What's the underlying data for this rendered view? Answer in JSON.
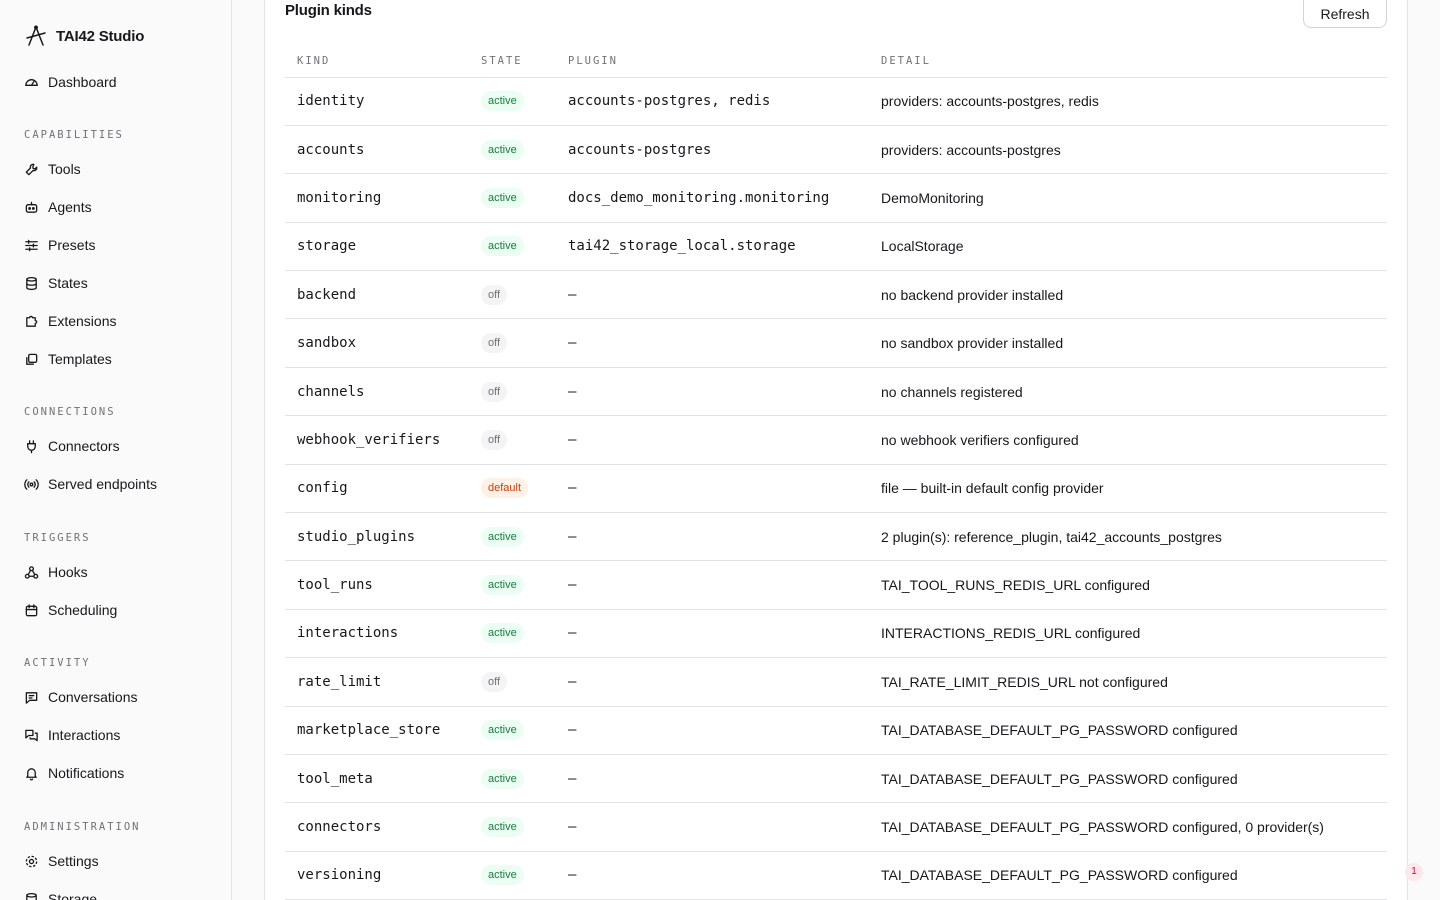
{
  "brand": {
    "name": "TAI42 Studio"
  },
  "nav": {
    "dashboard": "Dashboard",
    "sections": {
      "capabilities": "CAPABILITIES",
      "connections": "CONNECTIONS",
      "triggers": "TRIGGERS",
      "activity": "ACTIVITY",
      "administration": "ADMINISTRATION"
    },
    "items": {
      "tools": "Tools",
      "agents": "Agents",
      "presets": "Presets",
      "states": "States",
      "extensions": "Extensions",
      "templates": "Templates",
      "connectors": "Connectors",
      "served_endpoints": "Served endpoints",
      "hooks": "Hooks",
      "scheduling": "Scheduling",
      "conversations": "Conversations",
      "interactions": "Interactions",
      "notifications": "Notifications",
      "settings": "Settings",
      "storage": "Storage"
    }
  },
  "card": {
    "title": "Plugin kinds",
    "refresh_label": "Refresh",
    "columns": [
      "KIND",
      "STATE",
      "PLUGIN",
      "DETAIL"
    ],
    "rows": [
      {
        "kind": "identity",
        "state": "active",
        "plugin": "accounts-postgres, redis",
        "detail": "providers: accounts-postgres, redis"
      },
      {
        "kind": "accounts",
        "state": "active",
        "plugin": "accounts-postgres",
        "detail": "providers: accounts-postgres"
      },
      {
        "kind": "monitoring",
        "state": "active",
        "plugin": "docs_demo_monitoring.monitoring",
        "detail": "DemoMonitoring"
      },
      {
        "kind": "storage",
        "state": "active",
        "plugin": "tai42_storage_local.storage",
        "detail": "LocalStorage"
      },
      {
        "kind": "backend",
        "state": "off",
        "plugin": "–",
        "detail": "no backend provider installed"
      },
      {
        "kind": "sandbox",
        "state": "off",
        "plugin": "–",
        "detail": "no sandbox provider installed"
      },
      {
        "kind": "channels",
        "state": "off",
        "plugin": "–",
        "detail": "no channels registered"
      },
      {
        "kind": "webhook_verifiers",
        "state": "off",
        "plugin": "–",
        "detail": "no webhook verifiers configured"
      },
      {
        "kind": "config",
        "state": "default",
        "plugin": "–",
        "detail": "file — built-in default config provider"
      },
      {
        "kind": "studio_plugins",
        "state": "active",
        "plugin": "–",
        "detail": "2 plugin(s): reference_plugin, tai42_accounts_postgres"
      },
      {
        "kind": "tool_runs",
        "state": "active",
        "plugin": "–",
        "detail": "TAI_TOOL_RUNS_REDIS_URL configured"
      },
      {
        "kind": "interactions",
        "state": "active",
        "plugin": "–",
        "detail": "INTERACTIONS_REDIS_URL configured"
      },
      {
        "kind": "rate_limit",
        "state": "off",
        "plugin": "–",
        "detail": "TAI_RATE_LIMIT_REDIS_URL not configured"
      },
      {
        "kind": "marketplace_store",
        "state": "active",
        "plugin": "–",
        "detail": "TAI_DATABASE_DEFAULT_PG_PASSWORD configured"
      },
      {
        "kind": "tool_meta",
        "state": "active",
        "plugin": "–",
        "detail": "TAI_DATABASE_DEFAULT_PG_PASSWORD configured"
      },
      {
        "kind": "connectors",
        "state": "active",
        "plugin": "–",
        "detail": "TAI_DATABASE_DEFAULT_PG_PASSWORD configured, 0 provider(s)"
      },
      {
        "kind": "versioning",
        "state": "active",
        "plugin": "–",
        "detail": "TAI_DATABASE_DEFAULT_PG_PASSWORD configured"
      }
    ]
  },
  "notification_badge": {
    "count": "1"
  },
  "colors": {
    "accent_active": "#15803d",
    "accent_default": "#c2410c",
    "border": "#e4e4e7"
  }
}
